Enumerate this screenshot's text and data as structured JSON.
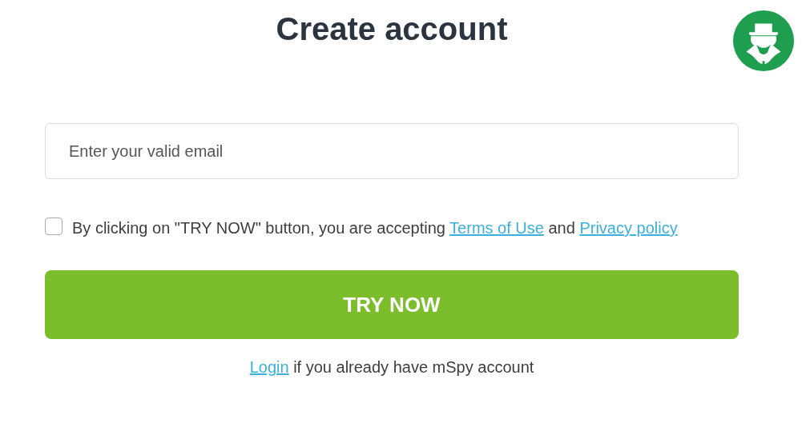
{
  "title": "Create account",
  "email_field": {
    "placeholder": "Enter your valid email"
  },
  "agreement": {
    "checked": false,
    "text_before": "By clicking on \"TRY NOW\" button, you are accepting",
    "terms_link": "Terms of Use",
    "text_middle": "and",
    "privacy_link": "Privacy policy"
  },
  "submit_button": "TRY NOW",
  "login_line": {
    "link": "Login",
    "text": "if you already have mSpy account"
  }
}
